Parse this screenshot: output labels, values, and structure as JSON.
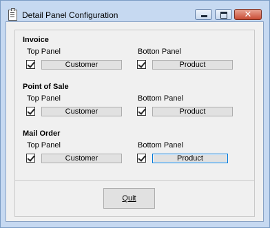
{
  "window": {
    "title": "Detail Panel Configuration",
    "close_glyph": "✕"
  },
  "sections": [
    {
      "title": "Invoice",
      "top_label": "Top Panel",
      "top_checked": true,
      "top_value": "Customer",
      "bottom_label": "Botton Panel",
      "bottom_checked": true,
      "bottom_value": "Product"
    },
    {
      "title": "Point of Sale",
      "top_label": "Top Panel",
      "top_checked": true,
      "top_value": "Customer",
      "bottom_label": "Bottom Panel",
      "bottom_checked": true,
      "bottom_value": "Product"
    },
    {
      "title": "Mail Order",
      "top_label": "Top Panel",
      "top_checked": true,
      "top_value": "Customer",
      "bottom_label": "Bottom Panel",
      "bottom_checked": true,
      "bottom_value": "Product"
    }
  ],
  "quit_label": "Quit"
}
